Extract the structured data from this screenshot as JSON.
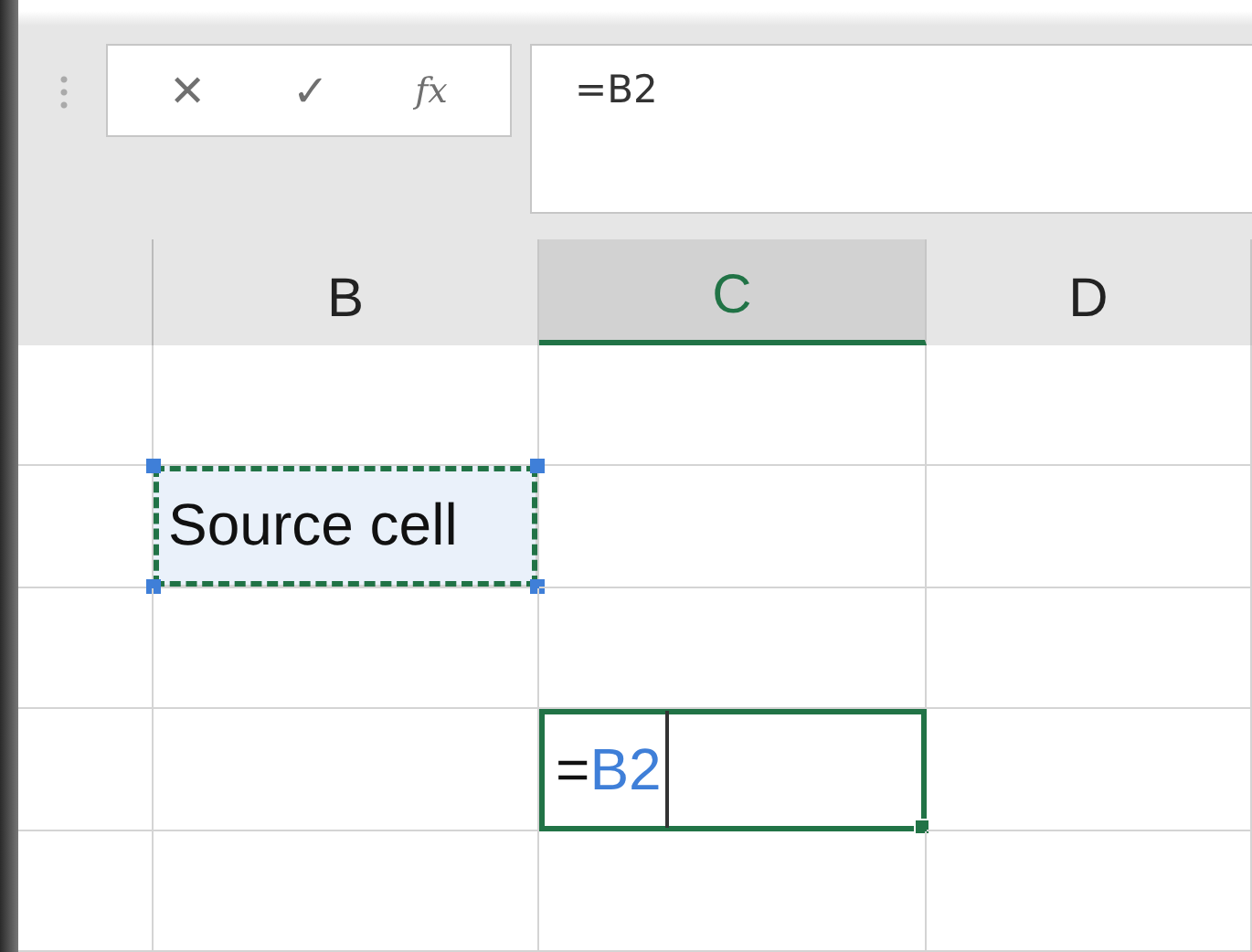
{
  "formula_bar": {
    "cancel": "✕",
    "enter": "✓",
    "function": "fx",
    "value": "=B2"
  },
  "columns": [
    {
      "selected": false
    },
    {
      "label": "B",
      "selected": false
    },
    {
      "label": "C",
      "selected": true
    },
    {
      "label": "D",
      "selected": false
    }
  ],
  "rows": [
    {
      "cells": [
        {
          "kind": "empty"
        },
        {
          "kind": "empty"
        },
        {
          "kind": "empty"
        },
        {
          "kind": "empty"
        }
      ]
    },
    {
      "cells": [
        {
          "kind": "empty"
        },
        {
          "kind": "copy-source",
          "text": "Source cell"
        },
        {
          "kind": "empty"
        },
        {
          "kind": "empty"
        }
      ]
    },
    {
      "cells": [
        {
          "kind": "empty"
        },
        {
          "kind": "empty"
        },
        {
          "kind": "empty"
        },
        {
          "kind": "empty"
        }
      ]
    },
    {
      "cells": [
        {
          "kind": "empty"
        },
        {
          "kind": "empty"
        },
        {
          "kind": "editing",
          "parts": [
            {
              "kind": "operator",
              "text": "="
            },
            {
              "kind": "reference",
              "text": "B2"
            }
          ]
        },
        {
          "kind": "empty"
        }
      ]
    },
    {
      "cells": [
        {
          "kind": "empty"
        },
        {
          "kind": "empty"
        },
        {
          "kind": "empty"
        },
        {
          "kind": "empty"
        }
      ]
    }
  ]
}
